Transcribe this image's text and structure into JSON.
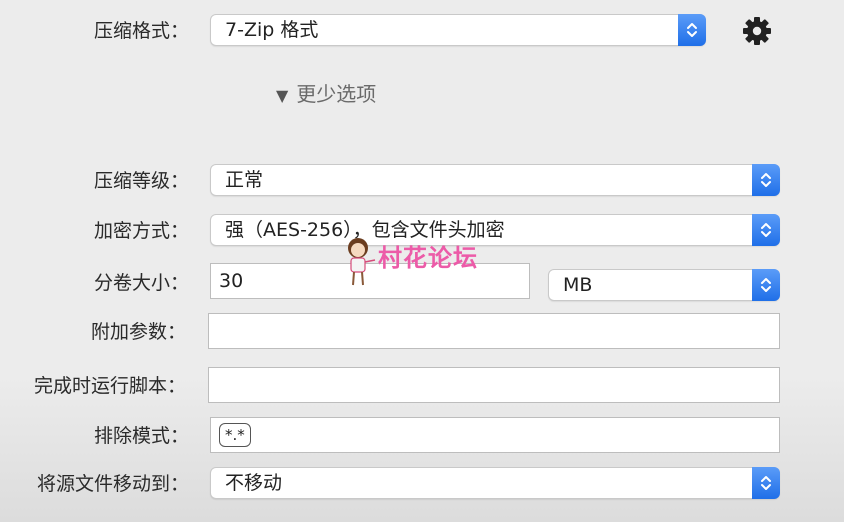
{
  "format": {
    "label": "压缩格式：",
    "value": "7-Zip 格式"
  },
  "disclosure": {
    "label": "更少选项"
  },
  "level": {
    "label": "压缩等级：",
    "value": "正常"
  },
  "encryption": {
    "label": "加密方式：",
    "value": "强（AES-256），包含文件头加密"
  },
  "split": {
    "label": "分卷大小：",
    "value": "30",
    "unit": "MB"
  },
  "extra_params": {
    "label": "附加参数：",
    "value": ""
  },
  "post_script": {
    "label": "完成时运行脚本：",
    "value": ""
  },
  "exclude": {
    "label": "排除模式：",
    "token": "*.*"
  },
  "move_source": {
    "label": "将源文件移动到：",
    "value": "不移动"
  },
  "watermark": {
    "text": "村花论坛"
  },
  "icons": {
    "settings": "gear-icon",
    "disclosure": "triangle-down-icon",
    "stepper": "updown-chevron-icon"
  },
  "colors": {
    "accent": "#2a7bf0",
    "watermark": "#ec5ba8"
  }
}
